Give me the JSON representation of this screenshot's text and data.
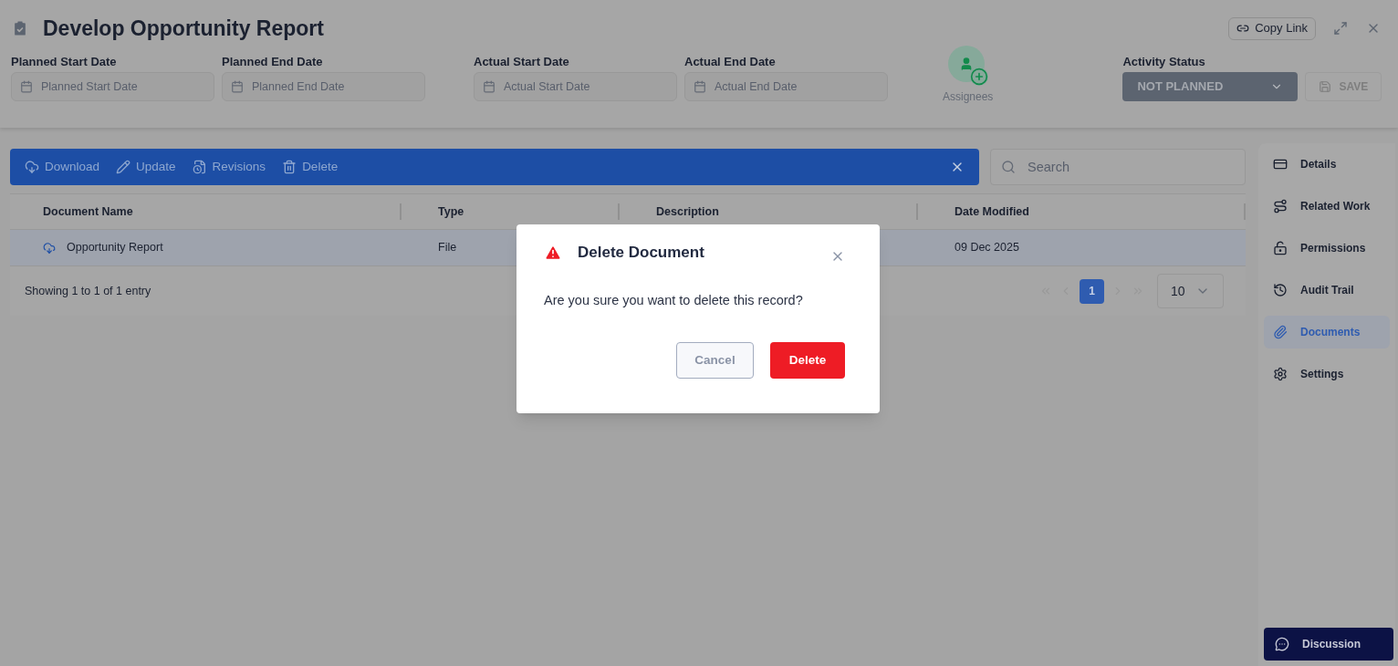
{
  "header": {
    "title": "Develop Opportunity Report",
    "copy_link": "Copy Link",
    "date_fields": [
      {
        "label": "Planned Start Date",
        "placeholder": "Planned Start Date"
      },
      {
        "label": "Planned End Date",
        "placeholder": "Planned End Date"
      },
      {
        "label": "Actual Start Date",
        "placeholder": "Actual Start Date"
      },
      {
        "label": "Actual End Date",
        "placeholder": "Actual End Date"
      }
    ],
    "assignees": "Assignees",
    "activity_status": {
      "label": "Activity Status",
      "value": "NOT PLANNED"
    },
    "save_button": {
      "label": "SAVE",
      "disabled": true
    }
  },
  "toolbar": {
    "actions": [
      {
        "label": "Download"
      },
      {
        "label": "Update"
      },
      {
        "label": "Revisions"
      },
      {
        "label": "Delete"
      }
    ],
    "search": {
      "placeholder": "Search"
    }
  },
  "table": {
    "columns": [
      "Document Name",
      "Type",
      "Description",
      "Date Modified"
    ],
    "rows": [
      {
        "cells": [
          "Opportunity Report",
          "File",
          "",
          "09 Dec 2025"
        ],
        "selected": true
      }
    ],
    "footer": "Showing 1 to 1 of 1 entry",
    "pages": [
      {
        "label": "1",
        "selected": true
      }
    ],
    "page_size": "10"
  },
  "sidebar": {
    "items": [
      {
        "label": "Details",
        "selected": false
      },
      {
        "label": "Related Work",
        "selected": false
      },
      {
        "label": "Permissions",
        "selected": false
      },
      {
        "label": "Audit Trail",
        "selected": false
      },
      {
        "label": "Documents",
        "selected": true
      },
      {
        "label": "Settings",
        "selected": false
      }
    ],
    "discussion": "Discussion"
  },
  "dialog": {
    "title": "Delete Document",
    "message": "Are you sure you want to delete this record?",
    "cancel": "Cancel",
    "confirm": "Delete"
  }
}
